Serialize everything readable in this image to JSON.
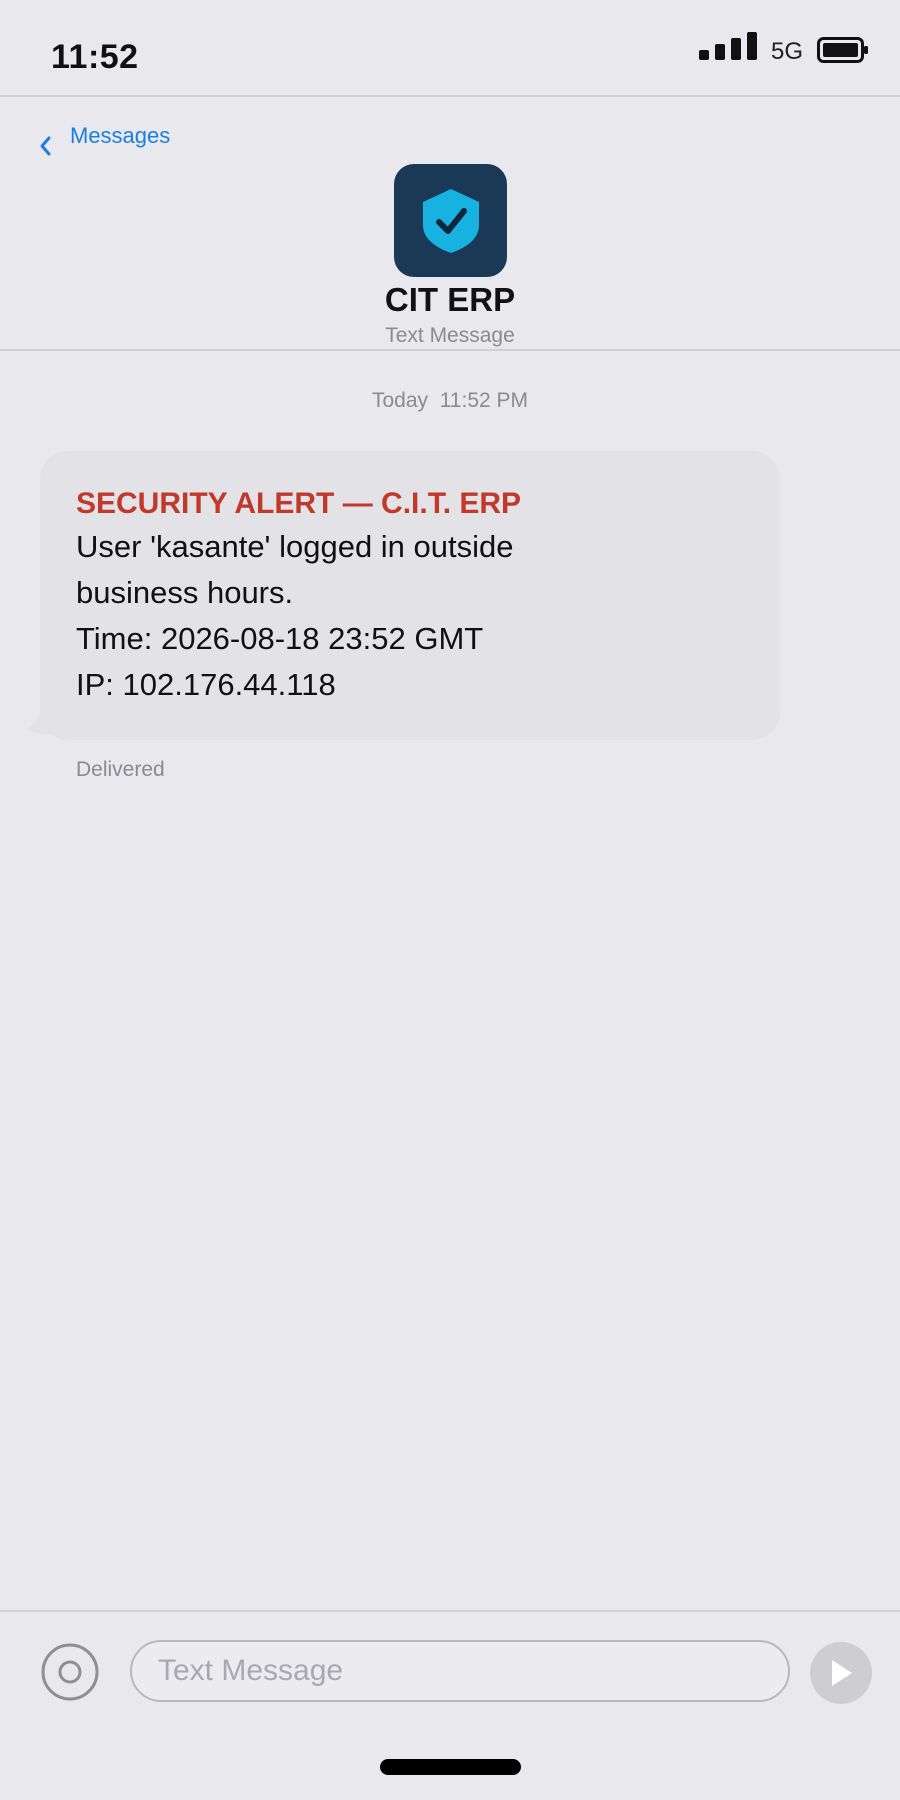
{
  "status_bar": {
    "time": "11:52",
    "network": "5G",
    "signal_icon": "cellular-signal-icon",
    "battery_icon": "battery-icon"
  },
  "nav": {
    "back_label": "Messages",
    "back_icon": "chevron-left-icon",
    "avatar_icon": "shield-check-icon",
    "contact_name": "CIT ERP",
    "contact_subtitle": "Text Message"
  },
  "conversation": {
    "timestamp_day": "Today",
    "timestamp_time": "11:52 PM",
    "message": {
      "title": "SECURITY ALERT — C.I.T. ERP",
      "lines": [
        "User 'kasante' logged in outside",
        "business hours.",
        "Time: 2026-08-18 23:52 GMT",
        "IP: 102.176.44.118"
      ],
      "status": "Delivered"
    }
  },
  "composer": {
    "placeholder": "Text Message",
    "value": "",
    "camera_icon": "camera-icon",
    "send_icon": "send-icon"
  },
  "colors": {
    "accent": "#1a7fe0",
    "alert": "#c0392b",
    "avatar_bg": "#1a3957",
    "shield": "#18b2e0",
    "background": "#e9e9ed",
    "bubble": "#e2e2e7"
  }
}
